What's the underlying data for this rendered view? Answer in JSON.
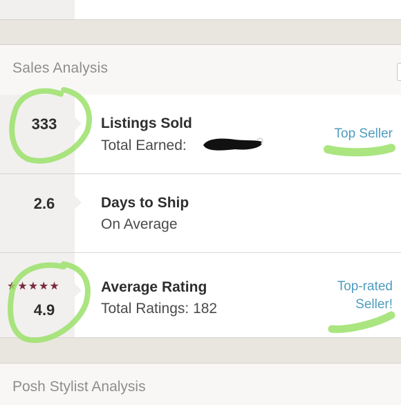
{
  "sales_section": {
    "title": "Sales Analysis",
    "rows": [
      {
        "stat": "333",
        "label": "Listings Sold",
        "sub": "Total Earned:",
        "badge": "Top Seller"
      },
      {
        "stat": "2.6",
        "label": "Days to Ship",
        "sub": "On Average"
      },
      {
        "stat": "4.9",
        "stars": "★★★★★",
        "rating": 4.9,
        "label": "Average Rating",
        "sub": "Total Ratings: 182",
        "badge_line1": "Top-rated",
        "badge_line2": "Seller!"
      }
    ]
  },
  "posh_section": {
    "title": "Posh Stylist Analysis"
  },
  "colors": {
    "accent_link": "#4f9cbf",
    "star": "#7b2a3b",
    "highlight": "#9be06a"
  }
}
